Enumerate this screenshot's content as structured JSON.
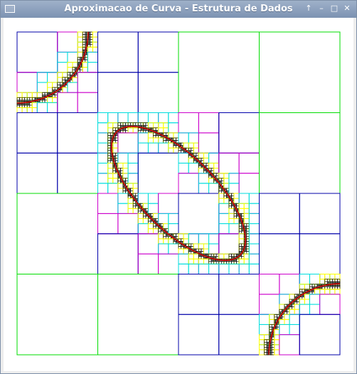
{
  "window": {
    "title": "Aproximacao de Curva - Estrutura de Dados",
    "controls": {
      "menu_icon": "window-menu-icon",
      "up_icon": "↑",
      "minimize_icon": "–",
      "maximize_icon": "□",
      "close_icon": "✕"
    }
  },
  "colors": {
    "level1": "#00dd00",
    "level2": "#0000aa",
    "level3": "#cc00cc",
    "level4": "#00dddd",
    "level5": "#ffff00",
    "fine": "#000000",
    "curve": "#cc0000",
    "background": "#ffffff"
  }
}
